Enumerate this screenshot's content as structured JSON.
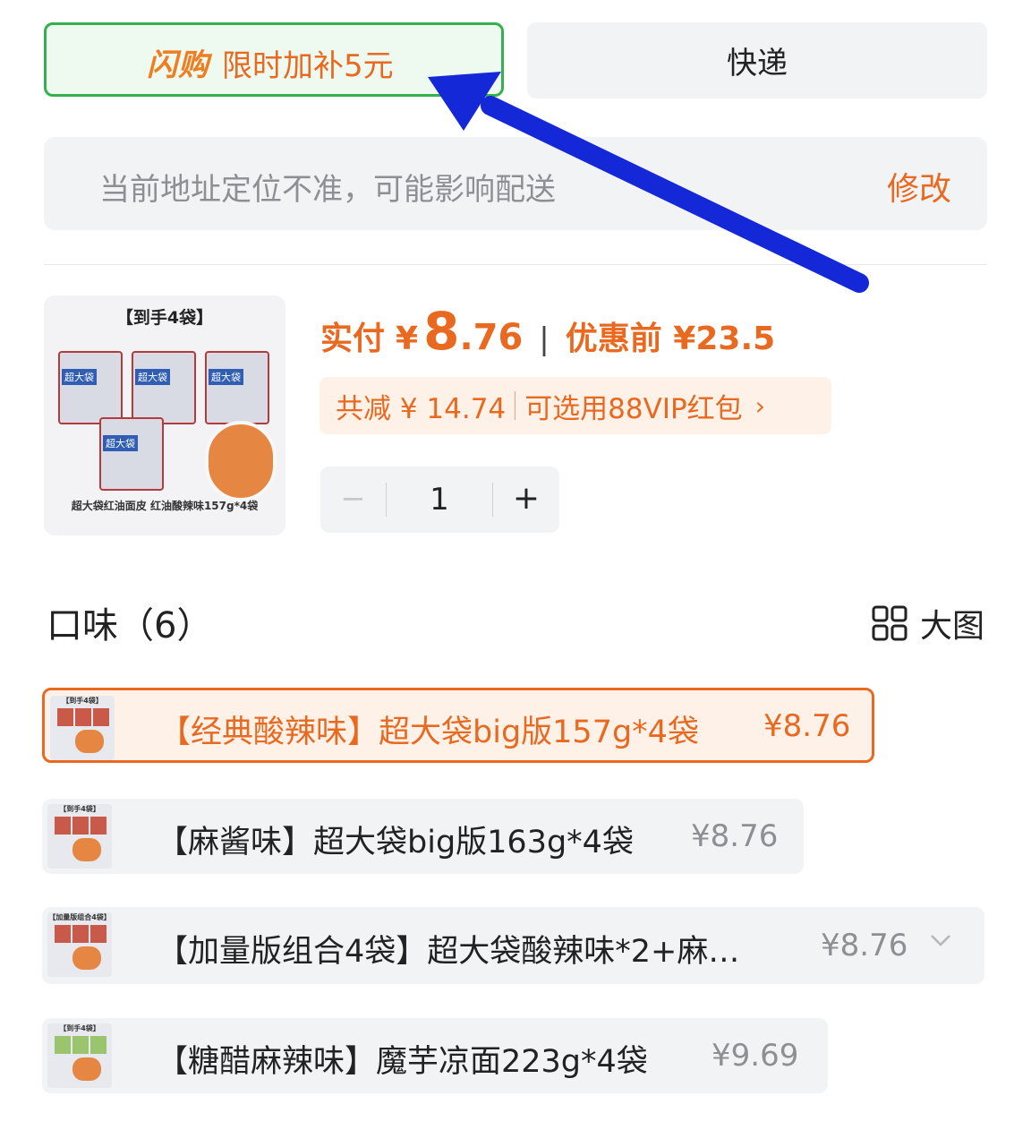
{
  "delivery_tabs": {
    "flash_logo": "闪购",
    "flash_text": "限时加补5元",
    "express_label": "快递"
  },
  "address": {
    "notice": "当前地址定位不准，可能影响配送",
    "edit_label": "修改"
  },
  "product": {
    "image_tag": "【到手4袋】",
    "image_bag_label": "超大袋",
    "image_caption": "超大袋红油面皮 红油酸辣味157g*4袋",
    "pay_label": "实付",
    "currency": "¥",
    "pay_int": "8",
    "pay_dec": ".76",
    "price_sep": "|",
    "before_label": "优惠前 ¥23.5",
    "discount_text": "共减 ¥ 14.74",
    "vip_text": "可选用88VIP红包",
    "vip_arrow": "›",
    "quantity": "1",
    "minus": "−",
    "plus": "+"
  },
  "flavor_section": {
    "title": "口味（6）",
    "big_view_label": "大图"
  },
  "options": [
    {
      "name": "【经典酸辣味】超大袋big版157g*4袋",
      "price": "¥8.76",
      "selected": true,
      "thumb_tag": "【到手4袋】"
    },
    {
      "name": "【麻酱味】超大袋big版163g*4袋",
      "price": "¥8.76",
      "selected": false,
      "thumb_tag": "【到手4袋】"
    },
    {
      "name": "【加量版组合4袋】超大袋酸辣味*2+麻…",
      "price": "¥8.76",
      "selected": false,
      "thumb_tag": "【加量版组合4袋】"
    },
    {
      "name": "【糖醋麻辣味】魔芋凉面223g*4袋",
      "price": "¥9.69",
      "selected": false,
      "thumb_tag": "【到手4袋】"
    }
  ],
  "colors": {
    "accent_orange": "#e8691f",
    "flash_green": "#35b04e",
    "annotation_arrow": "#1428d8"
  }
}
